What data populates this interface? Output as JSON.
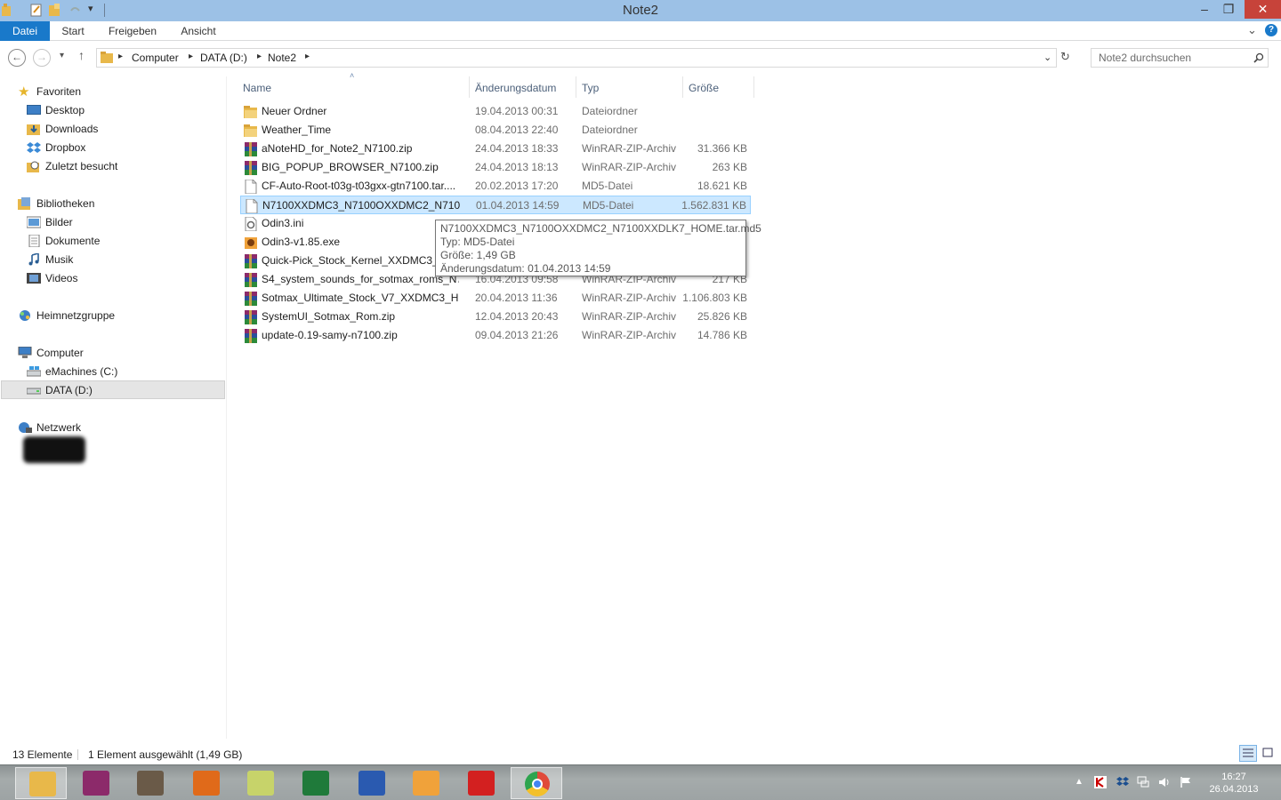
{
  "window": {
    "title": "Note2"
  },
  "ribbon": {
    "tabs": [
      "Datei",
      "Start",
      "Freigeben",
      "Ansicht"
    ]
  },
  "address": {
    "crumbs": [
      "Computer",
      "DATA (D:)",
      "Note2"
    ],
    "search_placeholder": "Note2 durchsuchen"
  },
  "nav": {
    "favorites": {
      "label": "Favoriten",
      "items": [
        "Desktop",
        "Downloads",
        "Dropbox",
        "Zuletzt besucht"
      ]
    },
    "libraries": {
      "label": "Bibliotheken",
      "items": [
        "Bilder",
        "Dokumente",
        "Musik",
        "Videos"
      ]
    },
    "homegroup": {
      "label": "Heimnetzgruppe"
    },
    "computer": {
      "label": "Computer",
      "items": [
        "eMachines (C:)",
        "DATA (D:)"
      ]
    },
    "network": {
      "label": "Netzwerk"
    }
  },
  "columns": {
    "name": "Name",
    "date": "Änderungsdatum",
    "type": "Typ",
    "size": "Größe"
  },
  "files": [
    {
      "name": "Neuer Ordner",
      "date": "19.04.2013 00:31",
      "type": "Dateiordner",
      "size": "",
      "icon": "folder-icon"
    },
    {
      "name": "Weather_Time",
      "date": "08.04.2013 22:40",
      "type": "Dateiordner",
      "size": "",
      "icon": "folder-icon"
    },
    {
      "name": "aNoteHD_for_Note2_N7100.zip",
      "date": "24.04.2013 18:33",
      "type": "WinRAR-ZIP-Archiv",
      "size": "31.366 KB",
      "icon": "winrar-icon"
    },
    {
      "name": "BIG_POPUP_BROWSER_N7100.zip",
      "date": "24.04.2013 18:13",
      "type": "WinRAR-ZIP-Archiv",
      "size": "263 KB",
      "icon": "winrar-icon"
    },
    {
      "name": "CF-Auto-Root-t03g-t03gxx-gtn7100.tar....",
      "date": "20.02.2013 17:20",
      "type": "MD5-Datei",
      "size": "18.621 KB",
      "icon": "file-icon"
    },
    {
      "name": "N7100XXDMC3_N7100OXXDMC2_N7100...",
      "date": "01.04.2013 14:59",
      "type": "MD5-Datei",
      "size": "1.562.831 KB",
      "icon": "file-icon"
    },
    {
      "name": "Odin3.ini",
      "date": "",
      "type": "",
      "size": "",
      "icon": "ini-icon"
    },
    {
      "name": "Odin3-v1.85.exe",
      "date": "",
      "type": "",
      "size": "",
      "icon": "exe-icon"
    },
    {
      "name": "Quick-Pick_Stock_Kernel_XXDMC3_N...",
      "date": "",
      "type": "",
      "size": "",
      "icon": "winrar-icon"
    },
    {
      "name": "S4_system_sounds_for_sotmax_roms_N7...",
      "date": "16.04.2013 09:58",
      "type": "WinRAR-ZIP-Archiv",
      "size": "217 KB",
      "icon": "winrar-icon"
    },
    {
      "name": "Sotmax_Ultimate_Stock_V7_XXDMC3_HD...",
      "date": "20.04.2013 11:36",
      "type": "WinRAR-ZIP-Archiv",
      "size": "1.106.803 KB",
      "icon": "winrar-icon"
    },
    {
      "name": "SystemUI_Sotmax_Rom.zip",
      "date": "12.04.2013 20:43",
      "type": "WinRAR-ZIP-Archiv",
      "size": "25.826 KB",
      "icon": "winrar-icon"
    },
    {
      "name": "update-0.19-samy-n7100.zip",
      "date": "09.04.2013 21:26",
      "type": "WinRAR-ZIP-Archiv",
      "size": "14.786 KB",
      "icon": "winrar-icon"
    }
  ],
  "tooltip": {
    "line1": "N7100XXDMC3_N7100OXXDMC2_N7100XXDLK7_HOME.tar.md5",
    "line2": "Typ: MD5-Datei",
    "line3": "Größe: 1,49 GB",
    "line4": "Änderungsdatum: 01.04.2013 14:59"
  },
  "status": {
    "count": "13 Elemente",
    "selection": "1 Element ausgewählt (1,49 GB)"
  },
  "taskbar": {
    "apps": [
      "file-explorer-icon",
      "winrar-icon",
      "gimp-icon",
      "faststone-icon",
      "notepad-icon",
      "excel-icon",
      "word-icon",
      "outlook-icon",
      "kaspersky-icon",
      "chrome-icon"
    ],
    "time": "16:27",
    "date": "26.04.2013"
  },
  "colors": {
    "accent": "#1979ca",
    "titlebar": "#9cc1e6",
    "selection": "#cce8ff",
    "close": "#c7433a"
  }
}
